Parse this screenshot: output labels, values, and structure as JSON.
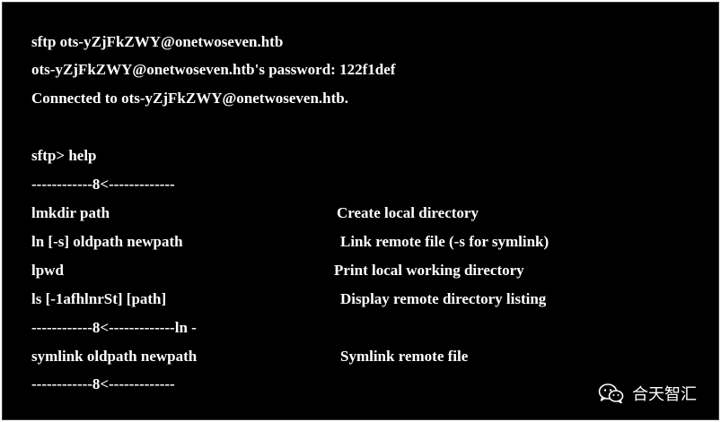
{
  "session": {
    "lines": [
      "sftp ots-yZjFkZWY@onetwoseven.htb",
      "ots-yZjFkZWY@onetwoseven.htb's password: 122f1def",
      "Connected to ots-yZjFkZWY@onetwoseven.htb.",
      "sftp> help",
      "------------8<-------------"
    ],
    "commands": [
      {
        "cmd": "lmkdir path",
        "desc": "Create local directory"
      },
      {
        "cmd": "ln [-s] oldpath newpath",
        "desc": "Link remote file (-s for symlink)"
      },
      {
        "cmd": "lpwd",
        "desc": "Print local working directory"
      },
      {
        "cmd": "ls [-1afhlnrSt] [path]",
        "desc": "Display remote directory listing"
      }
    ],
    "separator_ln": "------------8<-------------ln -",
    "commands2": [
      {
        "cmd": "symlink oldpath newpath",
        "desc": "Symlink remote file"
      }
    ],
    "separator_end": "------------8<-------------"
  },
  "watermark": {
    "icon": "wechat-icon",
    "text": "合天智汇"
  }
}
